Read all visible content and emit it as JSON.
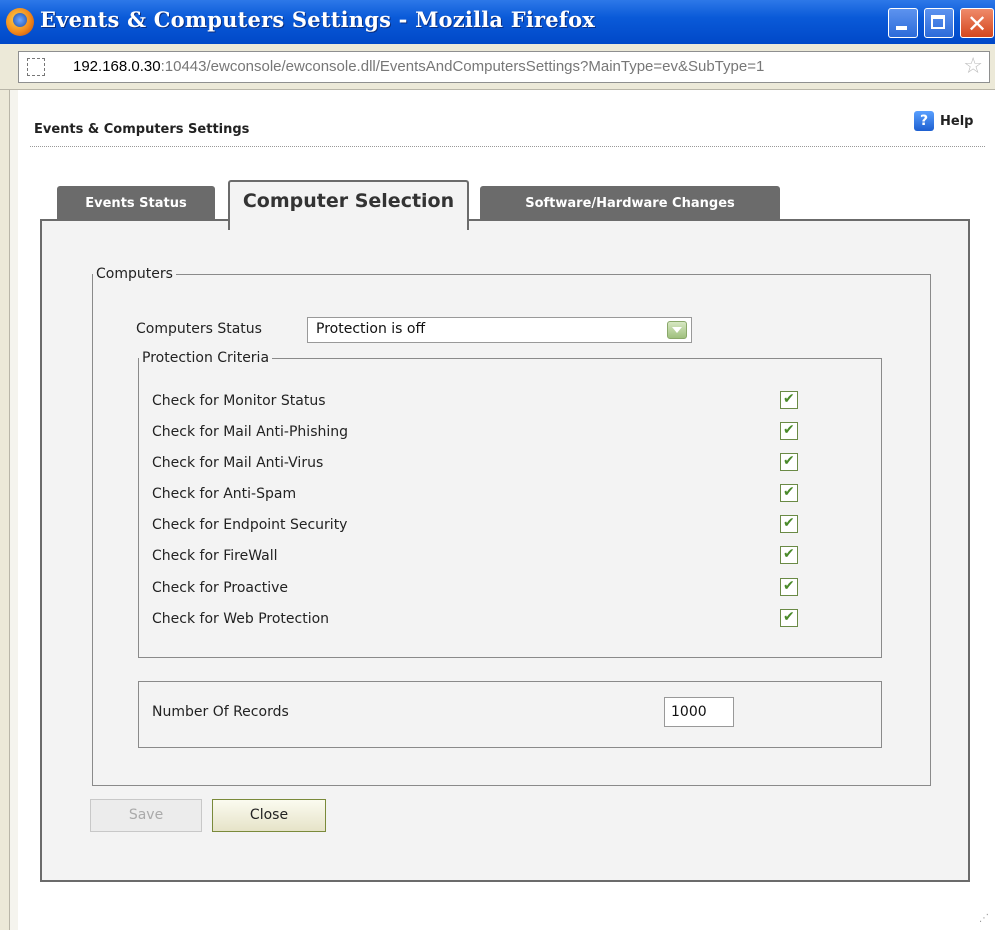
{
  "window": {
    "title": "Events & Computers Settings - Mozilla Firefox"
  },
  "address_bar": {
    "host": "192.168.0.30",
    "path": ":10443/ewconsole/ewconsole.dll/EventsAndComputersSettings?MainType=ev&SubType=1"
  },
  "page": {
    "title": "Events & Computers Settings",
    "help_label": "Help"
  },
  "tabs": [
    {
      "label": "Events Status",
      "active": false
    },
    {
      "label": "Computer Selection",
      "active": true
    },
    {
      "label": "Software/Hardware Changes",
      "active": false
    }
  ],
  "computers": {
    "legend": "Computers",
    "status_label": "Computers Status",
    "status_value": "Protection is off",
    "criteria_legend": "Protection Criteria",
    "criteria": [
      {
        "label": "Check for Monitor Status",
        "checked": true
      },
      {
        "label": "Check for Mail Anti-Phishing",
        "checked": true
      },
      {
        "label": "Check for Mail Anti-Virus",
        "checked": true
      },
      {
        "label": "Check for Anti-Spam",
        "checked": true
      },
      {
        "label": "Check for Endpoint Security",
        "checked": true
      },
      {
        "label": "Check for FireWall",
        "checked": true
      },
      {
        "label": "Check for Proactive",
        "checked": true
      },
      {
        "label": "Check for Web Protection",
        "checked": true
      }
    ],
    "records_label": "Number Of Records",
    "records_value": "1000"
  },
  "buttons": {
    "save": "Save",
    "close": "Close"
  },
  "colors": {
    "titlebar": "#0a5ad8",
    "tab_inactive": "#6b6b6b",
    "panel_bg": "#f3f3f3",
    "check": "#4a8a2a"
  }
}
